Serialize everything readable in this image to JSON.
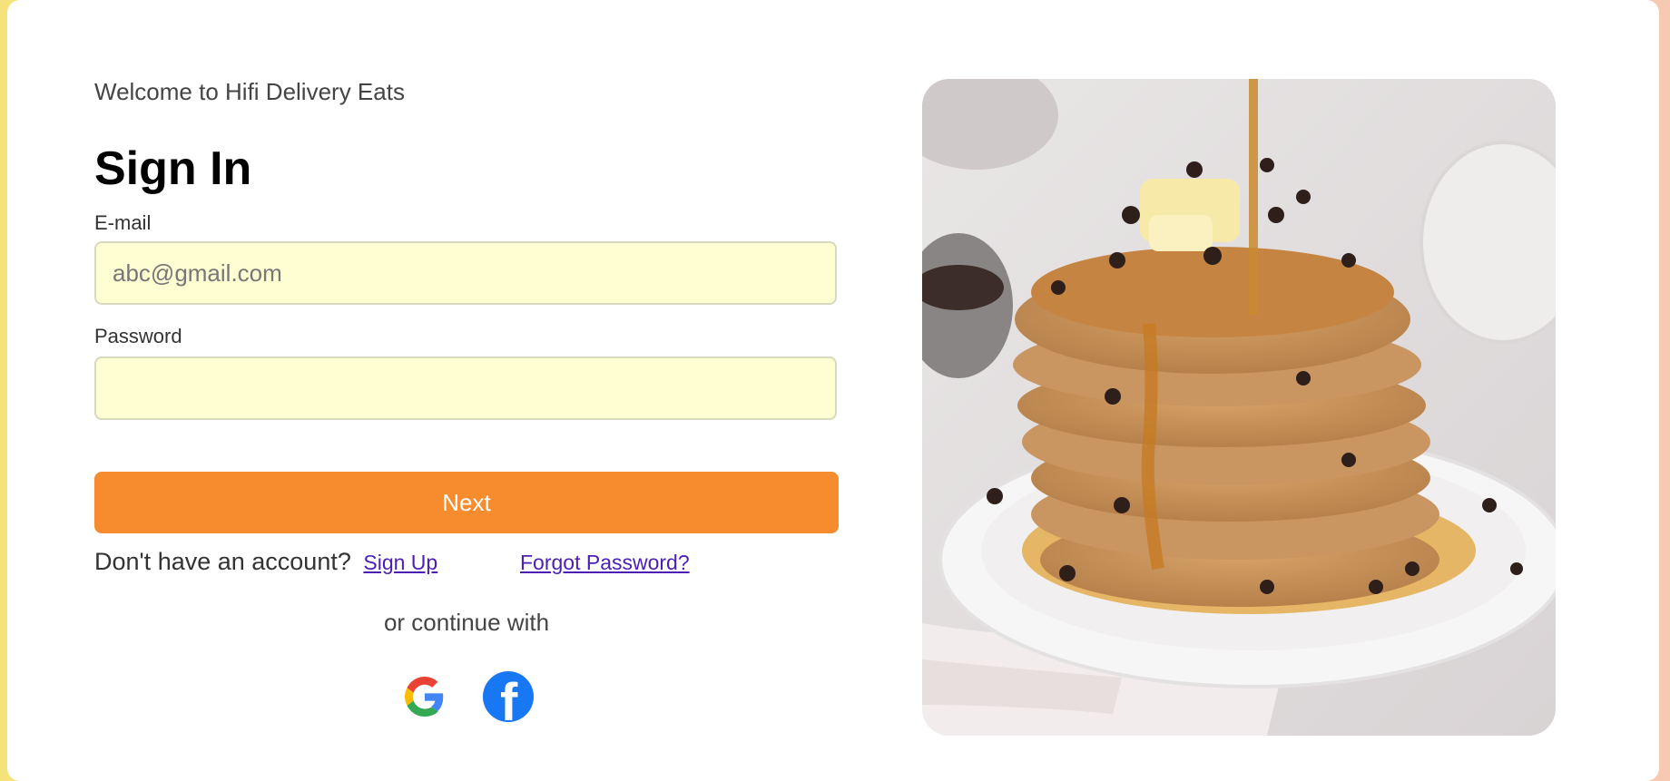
{
  "page": {
    "welcome": "Welcome to Hifi Delivery Eats",
    "title": "Sign In"
  },
  "form": {
    "email_label": "E-mail",
    "email_placeholder": "abc@gmail.com",
    "email_value": "",
    "password_label": "Password",
    "password_value": "",
    "next_label": "Next"
  },
  "links": {
    "no_account_text": "Don't have an account?",
    "signup_label": "Sign Up",
    "forgot_label": "Forgot Password?"
  },
  "social": {
    "continue_text": "or continue with",
    "google_icon": "google-icon",
    "facebook_icon": "facebook-icon",
    "facebook_glyph": "f"
  },
  "image": {
    "subject": "pancakes-photo"
  },
  "colors": {
    "accent": "#f68c2e",
    "input_bg": "#fefed2",
    "link": "#4b1fb5",
    "facebook": "#1877f2"
  }
}
